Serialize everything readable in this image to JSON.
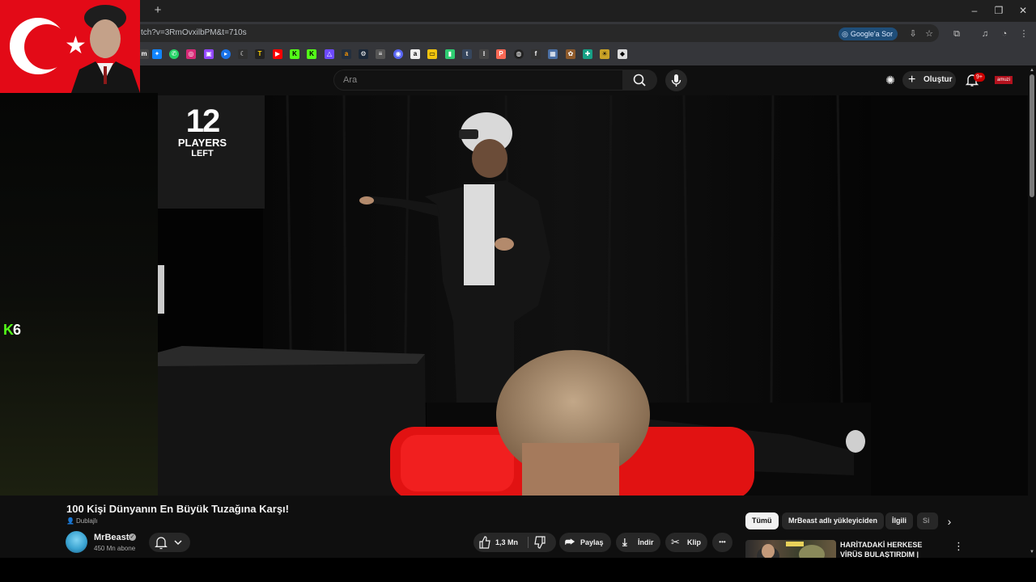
{
  "browser": {
    "new_tab": "+",
    "window_controls": [
      "–",
      "❐",
      "✕"
    ],
    "url": "tch?v=3RmOvxilbPM&t=710s",
    "google_sor": "Google'a Sor",
    "bookmark_icons": [
      "bluesky-icon",
      "whatsapp-icon",
      "instagram-icon",
      "twitch-icon",
      "play-icon",
      "tr-icon",
      "youtube-icon",
      "kick-icon",
      "kick-icon",
      "proton-icon",
      "amazon-icon",
      "steam-icon",
      "book-icon",
      "discord-icon",
      "a-icon",
      "chat-icon",
      "green-icon",
      "tumblr-icon",
      "grid-icon",
      "patreon-icon",
      "github-icon",
      "f-icon",
      "image-icon",
      "paw-icon",
      "puzzle-icon",
      "sun-icon",
      "diamond-icon"
    ],
    "colors": {
      "tab_strip": "#1f1f1f",
      "toolbar": "#35363a",
      "google_sor_bg": "#1f4e79"
    }
  },
  "overlay": {
    "kick_badge_letter": "K",
    "kick_badge_count": "6",
    "flag_colors": {
      "red": "#e30a17",
      "white": "#ffffff"
    }
  },
  "youtube": {
    "search_placeholder": "Ara",
    "create_label": "Oluştur",
    "notifications_badge": "9+",
    "avatar_text": "amuzi"
  },
  "video": {
    "counter_number": "12",
    "counter_word_1": "PLAYERS",
    "counter_word_2": "LEFT"
  },
  "watch": {
    "title": "100 Kişi Dünyanın En Büyük Tuzağına Karşı!",
    "dubbed_label": "Dublajlı",
    "channel_name": "MrBeast",
    "subscribers": "450 Mn abone",
    "like_count": "1,3 Mn",
    "share_label": "Paylaş",
    "download_label": "İndir",
    "clip_label": "Klip",
    "more_label": "•••"
  },
  "sidebar": {
    "chips": [
      "Tümü",
      "MrBeast adlı yükleyiciden",
      "İlgili",
      "Si"
    ],
    "recommendation_title": "HARİTADAKİ HERKESE VİRÜS BULAŞTIRDIM | GOOSE GOOS"
  }
}
